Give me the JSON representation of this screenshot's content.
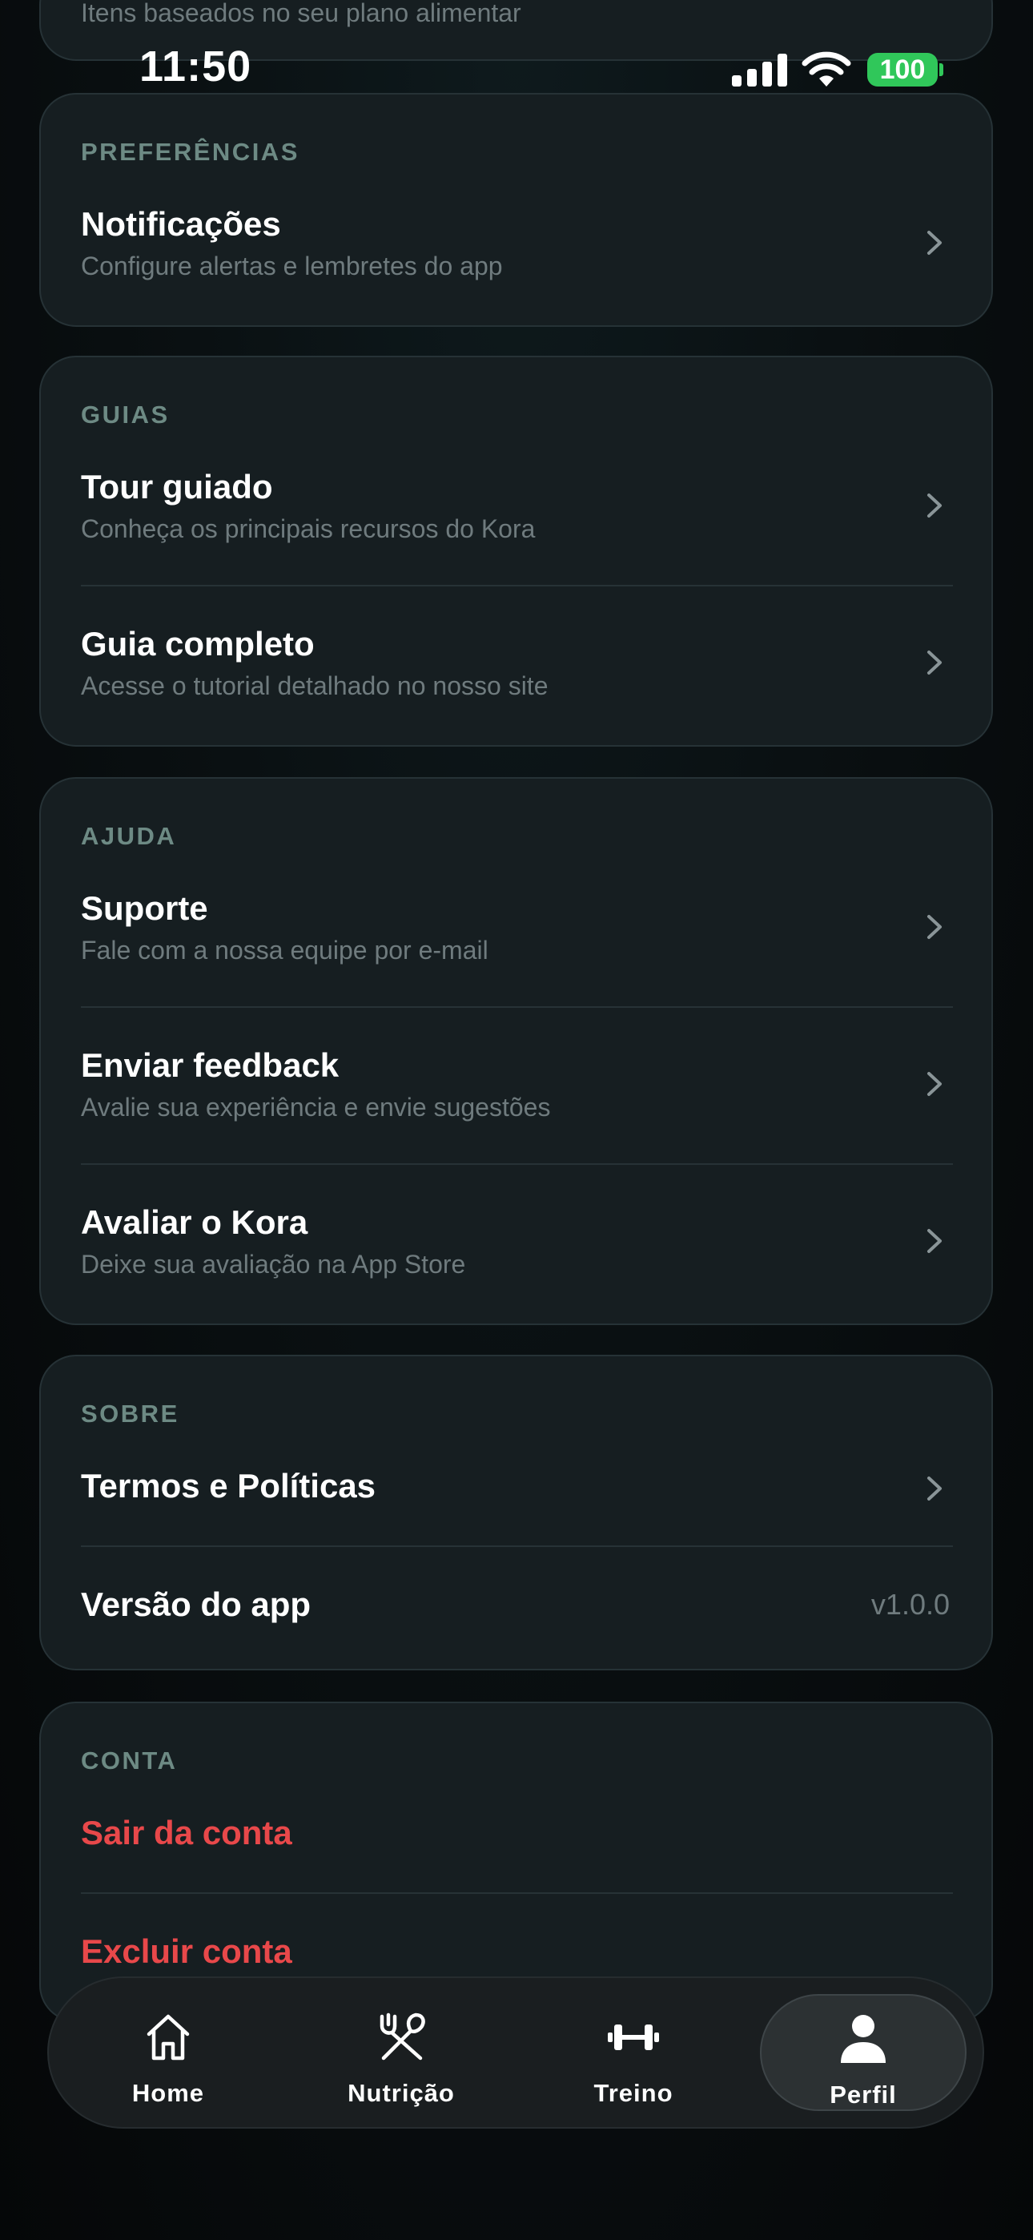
{
  "status_bar": {
    "time": "11:50",
    "battery": "100"
  },
  "top_card": {
    "subtitle": "Itens baseados no seu plano alimentar"
  },
  "preferencias": {
    "label": "PREFERÊNCIAS",
    "items": [
      {
        "title": "Notificações",
        "subtitle": "Configure alertas e lembretes do app"
      }
    ]
  },
  "guias": {
    "label": "GUIAS",
    "items": [
      {
        "title": "Tour guiado",
        "subtitle": "Conheça os principais recursos do Kora"
      },
      {
        "title": "Guia completo",
        "subtitle": "Acesse o tutorial detalhado no nosso site"
      }
    ]
  },
  "ajuda": {
    "label": "AJUDA",
    "items": [
      {
        "title": "Suporte",
        "subtitle": "Fale com a nossa equipe por e-mail"
      },
      {
        "title": "Enviar feedback",
        "subtitle": "Avalie sua experiência e envie sugestões"
      },
      {
        "title": "Avaliar o Kora",
        "subtitle": "Deixe sua avaliação na App Store"
      }
    ]
  },
  "sobre": {
    "label": "SOBRE",
    "terms": "Termos e Políticas",
    "version_label": "Versão do app",
    "version_value": "v1.0.0"
  },
  "conta": {
    "label": "CONTA",
    "logout": "Sair da conta",
    "delete": "Excluir conta"
  },
  "tabbar": {
    "tabs": [
      {
        "label": "Home",
        "icon": "home-icon"
      },
      {
        "label": "Nutrição",
        "icon": "fork-knife-icon"
      },
      {
        "label": "Treino",
        "icon": "dumbbell-icon"
      },
      {
        "label": "Perfil",
        "icon": "person-icon"
      }
    ],
    "active": "Perfil"
  },
  "colors": {
    "danger": "#e8484a",
    "battery": "#30c75a",
    "section_label": "#6d8a84"
  }
}
